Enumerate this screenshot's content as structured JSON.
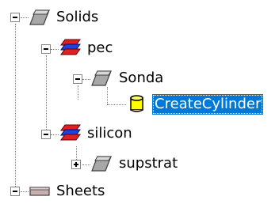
{
  "tree": {
    "nodes": [
      {
        "label": "Solids",
        "icon": "solid-icon",
        "expander": "minus"
      },
      {
        "label": "pec",
        "icon": "material-icon",
        "expander": "minus"
      },
      {
        "label": "Sonda",
        "icon": "solid-icon",
        "expander": "minus"
      },
      {
        "label": "CreateCylinder",
        "icon": "cylinder-icon",
        "expander": "none",
        "selected": true
      },
      {
        "label": "silicon",
        "icon": "material-icon",
        "expander": "minus"
      },
      {
        "label": "supstrat",
        "icon": "solid-icon",
        "expander": "plus"
      },
      {
        "label": "Sheets",
        "icon": "sheet-icon",
        "expander": "minus"
      }
    ]
  },
  "colors": {
    "selection": "#0078d7",
    "material_red": "#e02020",
    "material_blue": "#2040e0",
    "solid_gray": "#9a9a9a",
    "cylinder_yellow": "#ffff00"
  }
}
